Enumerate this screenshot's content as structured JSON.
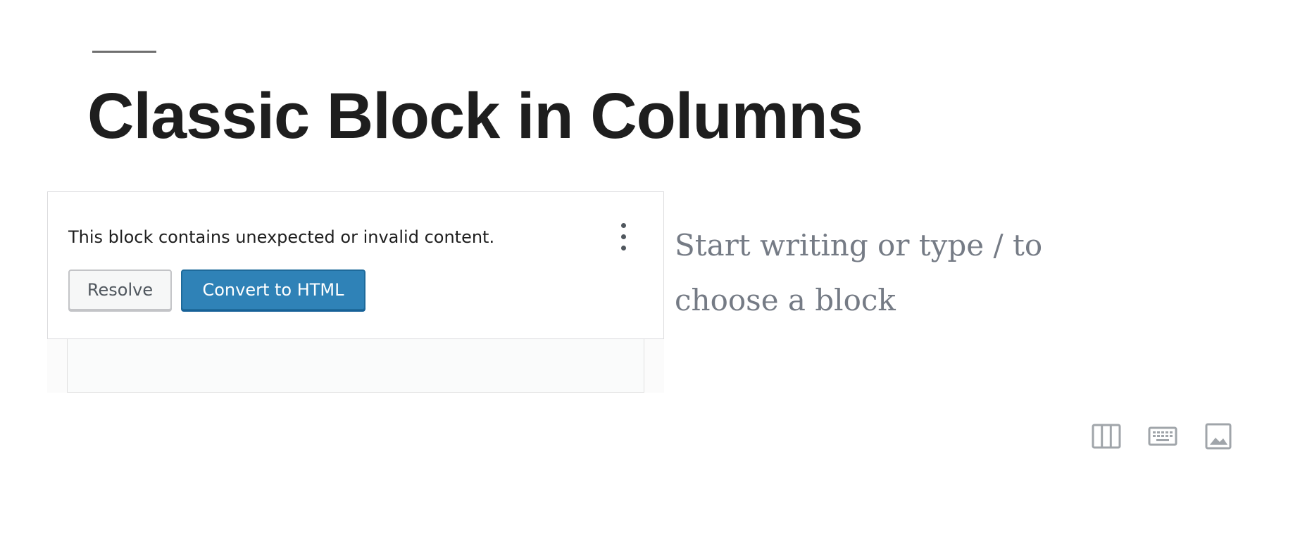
{
  "post": {
    "title": "Classic Block in Columns"
  },
  "invalid_block": {
    "message": "This block contains unexpected or invalid content.",
    "resolve_label": "Resolve",
    "convert_label": "Convert to HTML",
    "more_icon": "more-vertical-icon"
  },
  "paragraph": {
    "placeholder": "Start writing or type / to choose a block"
  },
  "inserter_shortcuts": [
    {
      "icon": "columns-icon"
    },
    {
      "icon": "keyboard-icon"
    },
    {
      "icon": "image-icon"
    }
  ],
  "colors": {
    "title": "#1e1e1e",
    "primary_button": "#2f82b7",
    "placeholder": "#757b85",
    "icon": "#a0a5aa"
  }
}
